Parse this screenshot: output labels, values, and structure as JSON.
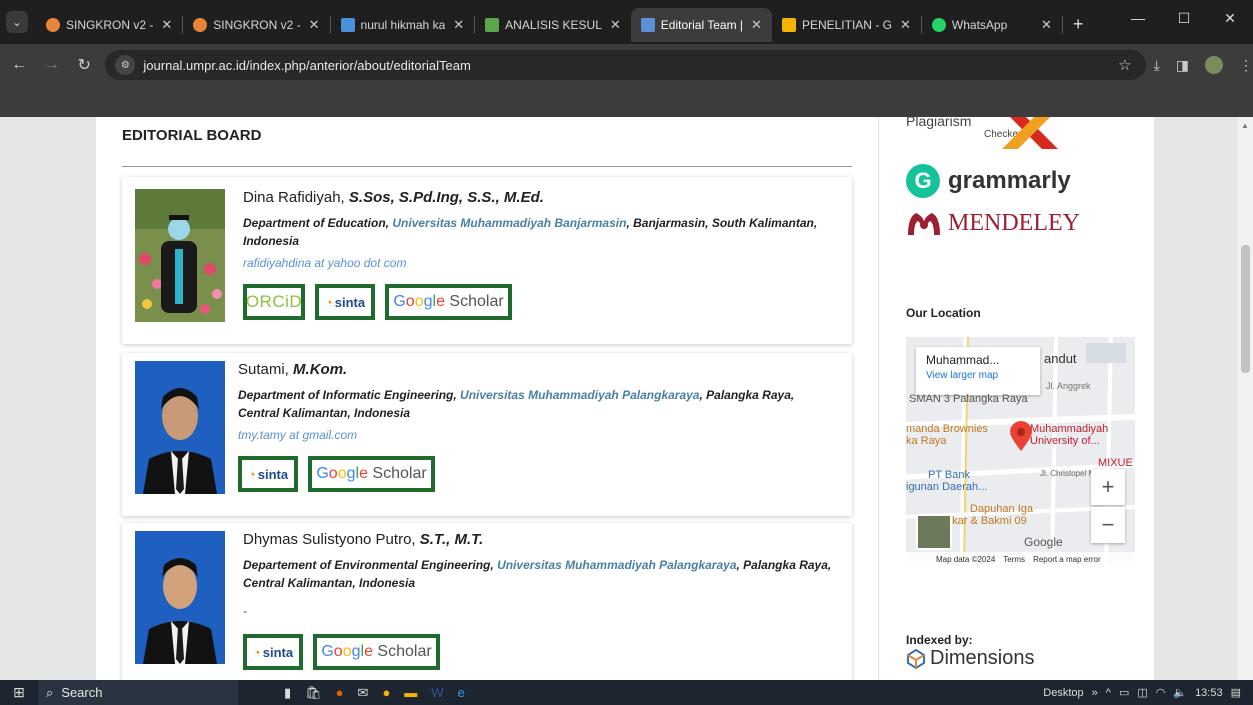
{
  "browser": {
    "tabs": [
      {
        "title": "SINGKRON v2 -",
        "active": false,
        "color": "#e8833a"
      },
      {
        "title": "SINGKRON v2 -",
        "active": false,
        "color": "#e8833a"
      },
      {
        "title": "nurul hikmah ka",
        "active": false,
        "color": "#4a90d9"
      },
      {
        "title": "ANALISIS KESUL",
        "active": false,
        "color": "#5aa84b"
      },
      {
        "title": "Editorial Team |",
        "active": true,
        "color": "#5b8fd6"
      },
      {
        "title": "PENELITIAN - G",
        "active": false,
        "color": "#f4b400"
      },
      {
        "title": "WhatsApp",
        "active": false,
        "color": "#25d366"
      }
    ],
    "new_tab": "+",
    "url": "journal.umpr.ac.id/index.php/anterior/about/editorialTeam"
  },
  "page": {
    "section_title": "EDITORIAL BOARD",
    "members": [
      {
        "name": "Dina Rafidiyah,",
        "degree": "S.Sos, S.Pd.Ing, S.S., M.Ed.",
        "dept_prefix": "Department of Education,",
        "university": "Universitas Muhammadiyah Banjarmasin",
        "dept_suffix": ", Banjarmasin, South Kalimantan, Indonesia",
        "email": "rafidiyahdina at yahoo dot com"
      },
      {
        "name": "Sutami,",
        "degree": "M.Kom.",
        "dept_prefix": "Department of Informatic Engineering,",
        "university": "Universitas Muhammadiyah Palangkaraya",
        "dept_suffix": ", Palangka Raya, Central Kalimantan, Indonesia",
        "email": "tmy.tamy at gmail.com"
      },
      {
        "name": "Dhymas Sulistyono Putro,",
        "degree": "S.T., M.T.",
        "dept_prefix": "Departement of Environmental Engineering,",
        "university": "Universitas Muhammadiyah Palangkaraya",
        "dept_suffix": ", Palangka Raya, Central Kalimantan, Indonesia",
        "email": "-"
      }
    ],
    "badges": {
      "orcid": "ORCiD",
      "sinta": "sinta",
      "scholar_google": "Google",
      "scholar_word": "Scholar"
    }
  },
  "sidebar": {
    "plagiarism": "Plagiarism",
    "checker": "Checker",
    "grammarly": "grammarly",
    "mendeley": "MENDELEY",
    "location_heading": "Our Location",
    "map": {
      "place": "Muhammad...",
      "view_larger": "View larger map",
      "labels": [
        "andut",
        "SMAN 3 Palangka Raya",
        "manda Brownies",
        "ka Raya",
        "Muhammadiyah",
        "University of...",
        "PT Bank",
        "igunan Daerah...",
        "Dapuhan Iga",
        "akar & Bakmi 09",
        "MIXUE",
        "Jl. Anggrek",
        "Jl. Christopel Mi"
      ],
      "footer_data": "Map data ©2024",
      "footer_terms": "Terms",
      "footer_report": "Report a map error",
      "google": "Google"
    },
    "indexed_heading": "Indexed by:",
    "dimensions": "Dimensions"
  },
  "taskbar": {
    "search": "Search",
    "desktop": "Desktop",
    "time": "13:53"
  }
}
